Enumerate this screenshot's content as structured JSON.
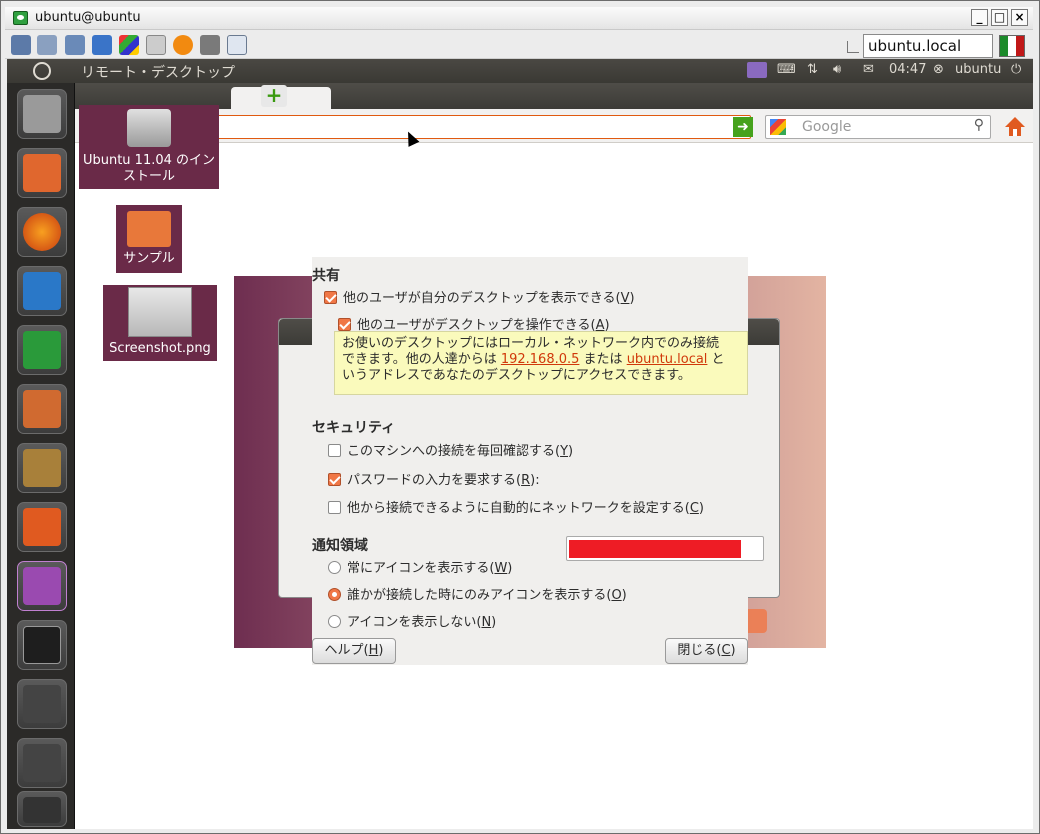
{
  "window": {
    "title": "ubuntu@ubuntu",
    "minimize": "_",
    "maximize": "□",
    "close": "×"
  },
  "toolbar": {
    "host": "ubuntu.local"
  },
  "panel": {
    "title": "リモート・デスクトップ",
    "time": "04:47",
    "user": "ubuntu"
  },
  "browser": {
    "search_placeholder": "Google",
    "new_tab": "+"
  },
  "desktop": {
    "install": "Ubuntu 11.04 のインストール",
    "folder": "サンプル",
    "screenshot": "Screenshot.png"
  },
  "dialog": {
    "sharing_header": "共有",
    "allow_view": "他のユーザが自分のデスクトップを表示できる(",
    "allow_view_key": "V",
    "allow_control": "他のユーザがデスクトップを操作できる(",
    "allow_control_key": "A",
    "note_line1": "お使いのデスクトップにはローカル・ネットワーク内でのみ接続",
    "note_line2a": "できます。他の人達からは ",
    "note_ip": "192.168.0.5",
    "note_mid": " または ",
    "note_host": "ubuntu.local",
    "note_line2b": " と",
    "note_line3": "いうアドレスであなたのデスクトップにアクセスできます。",
    "security_header": "セキュリティ",
    "confirm_each": "このマシンへの接続を毎回確認する(",
    "confirm_each_key": "Y",
    "require_pw": "パスワードの入力を要求する(",
    "require_pw_key": "R",
    "require_pw_suffix": "):",
    "auto_network": "他から接続できるように自動的にネットワークを設定する(",
    "auto_network_key": "C",
    "notify_header": "通知領域",
    "always_icon": "常にアイコンを表示する(",
    "always_icon_key": "W",
    "only_connected": "誰かが接続した時にのみアイコンを表示する(",
    "only_connected_key": "O",
    "never_icon": "アイコンを表示しない(",
    "never_icon_key": "N",
    "help_btn": "ヘルプ(",
    "help_key": "H",
    "close_btn": "閉じる(",
    "close_key": "C",
    "paren": ")"
  },
  "colors": {
    "accent": "#f07746",
    "panel": "#3c3b37",
    "mask": "#ee1c25"
  }
}
